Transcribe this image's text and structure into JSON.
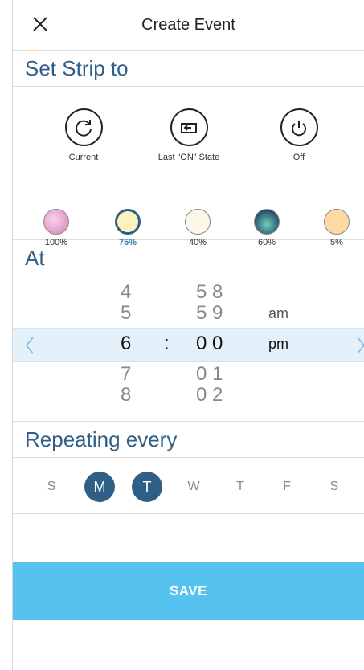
{
  "nav": {
    "title": "Create Event",
    "close_icon": "close-icon"
  },
  "set_strip": {
    "heading": "Set Strip to",
    "buttons": [
      {
        "label": "Current",
        "icon": "refresh-icon"
      },
      {
        "label": "Last “ON” State",
        "icon": "return-icon"
      },
      {
        "label": "Off",
        "icon": "power-icon"
      }
    ],
    "swatches": [
      {
        "pct": "100%",
        "color": "#e39acb",
        "selected": false
      },
      {
        "pct": "75%",
        "color": "#fdf2bd",
        "selected": true
      },
      {
        "pct": "40%",
        "color": "#fdf7ea",
        "selected": false
      },
      {
        "pct": "60%",
        "color": "#3a6a79",
        "selected": false
      },
      {
        "pct": "5%",
        "color": "#fed9a6",
        "selected": false
      }
    ]
  },
  "at": {
    "heading": "At",
    "hours": [
      "4",
      "5",
      "6",
      "7",
      "8"
    ],
    "minutes": [
      "5 8",
      "5 9",
      "0 0",
      "0 1",
      "0 2"
    ],
    "separator": ":",
    "ampm": [
      "am",
      "pm"
    ]
  },
  "repeat": {
    "heading": "Repeating every",
    "days": [
      {
        "label": "S",
        "on": false
      },
      {
        "label": "M",
        "on": true
      },
      {
        "label": "T",
        "on": true
      },
      {
        "label": "W",
        "on": false
      },
      {
        "label": "T",
        "on": false
      },
      {
        "label": "F",
        "on": false
      },
      {
        "label": "S",
        "on": false
      }
    ]
  },
  "save_label": "SAVE",
  "colors": {
    "accent": "#2f5f86",
    "save": "#55c3ee",
    "band": "#e4f1fa"
  }
}
